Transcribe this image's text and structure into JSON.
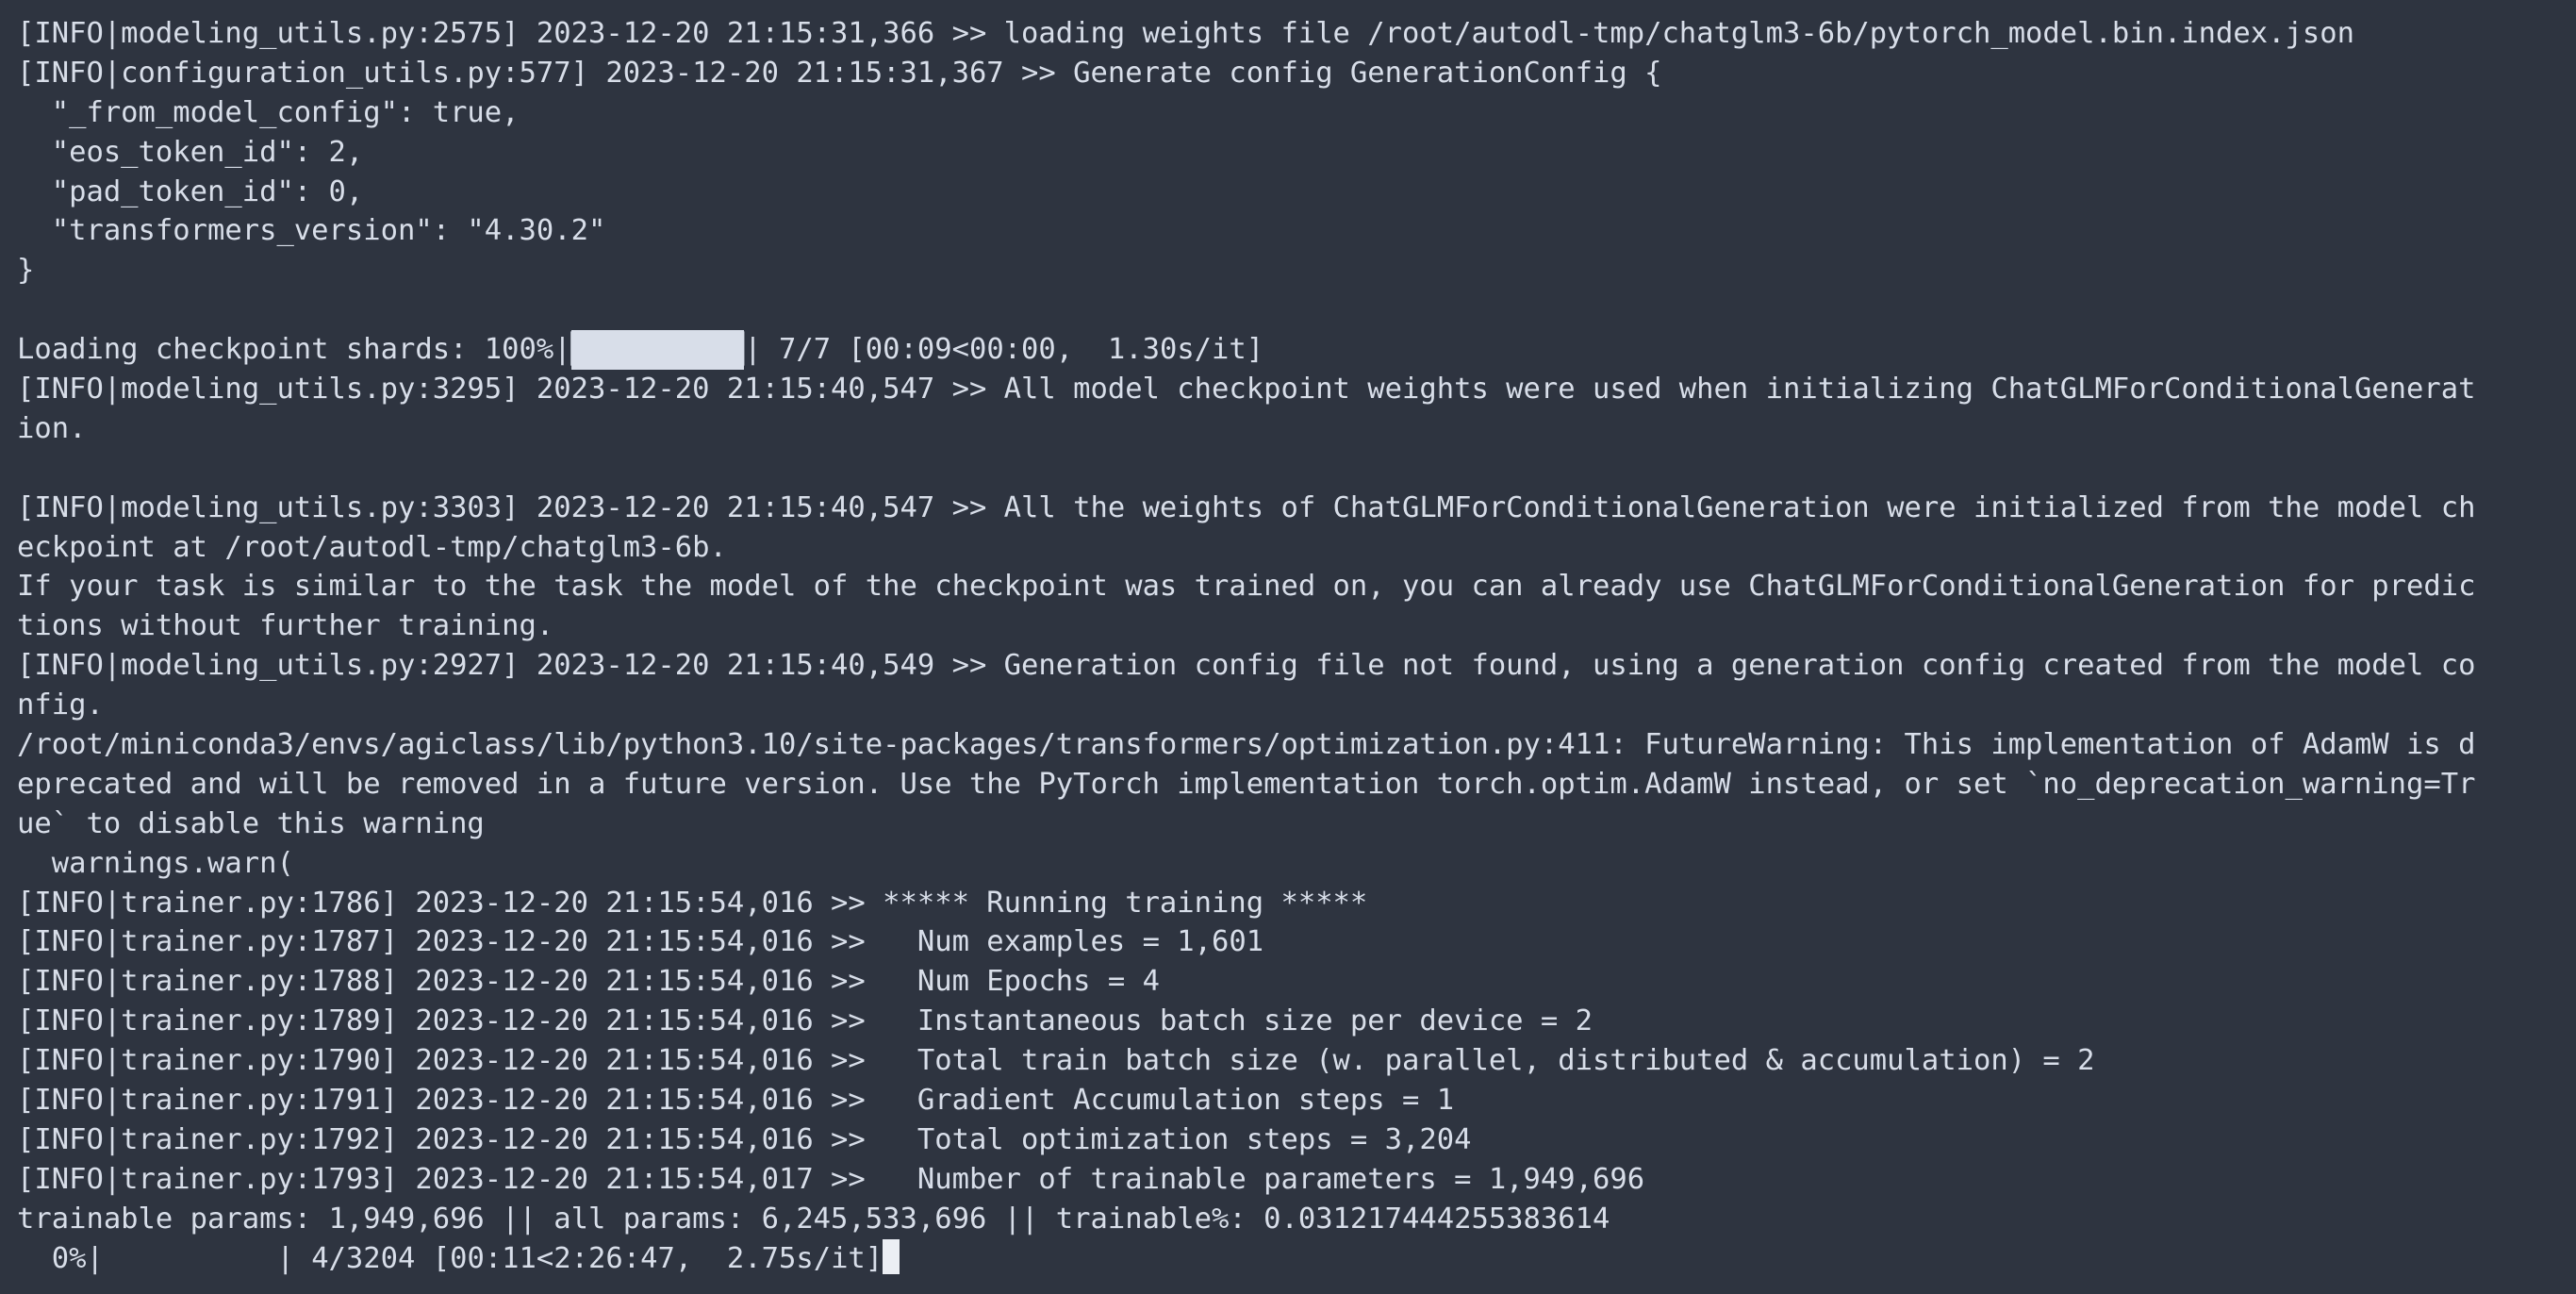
{
  "terminal": {
    "lines": [
      {
        "text": "[INFO|modeling_utils.py:2575] 2023-12-20 21:15:31,366 >> loading weights file /root/autodl-tmp/chatglm3-6b/pytorch_model.bin.index.json"
      },
      {
        "text": "[INFO|configuration_utils.py:577] 2023-12-20 21:15:31,367 >> Generate config GenerationConfig {"
      },
      {
        "text": "  \"_from_model_config\": true,"
      },
      {
        "text": "  \"eos_token_id\": 2,"
      },
      {
        "text": "  \"pad_token_id\": 0,"
      },
      {
        "text": "  \"transformers_version\": \"4.30.2\""
      },
      {
        "text": "}"
      },
      {
        "text": ""
      },
      {
        "progress": {
          "prefix": "Loading checkpoint shards: 100%|",
          "fill": "██████████",
          "empty": "",
          "suffix": "| 7/7 [00:09<00:00,  1.30s/it]",
          "percent": 100
        }
      },
      {
        "text": "[INFO|modeling_utils.py:3295] 2023-12-20 21:15:40,547 >> All model checkpoint weights were used when initializing ChatGLMForConditionalGenerat"
      },
      {
        "text": "ion."
      },
      {
        "text": ""
      },
      {
        "text": "[INFO|modeling_utils.py:3303] 2023-12-20 21:15:40,547 >> All the weights of ChatGLMForConditionalGeneration were initialized from the model ch"
      },
      {
        "text": "eckpoint at /root/autodl-tmp/chatglm3-6b."
      },
      {
        "text": "If your task is similar to the task the model of the checkpoint was trained on, you can already use ChatGLMForConditionalGeneration for predic"
      },
      {
        "text": "tions without further training."
      },
      {
        "text": "[INFO|modeling_utils.py:2927] 2023-12-20 21:15:40,549 >> Generation config file not found, using a generation config created from the model co"
      },
      {
        "text": "nfig."
      },
      {
        "text": "/root/miniconda3/envs/agiclass/lib/python3.10/site-packages/transformers/optimization.py:411: FutureWarning: This implementation of AdamW is d"
      },
      {
        "text": "eprecated and will be removed in a future version. Use the PyTorch implementation torch.optim.AdamW instead, or set `no_deprecation_warning=Tr"
      },
      {
        "text": "ue` to disable this warning"
      },
      {
        "text": "  warnings.warn("
      },
      {
        "text": "[INFO|trainer.py:1786] 2023-12-20 21:15:54,016 >> ***** Running training *****"
      },
      {
        "text": "[INFO|trainer.py:1787] 2023-12-20 21:15:54,016 >>   Num examples = 1,601"
      },
      {
        "text": "[INFO|trainer.py:1788] 2023-12-20 21:15:54,016 >>   Num Epochs = 4"
      },
      {
        "text": "[INFO|trainer.py:1789] 2023-12-20 21:15:54,016 >>   Instantaneous batch size per device = 2"
      },
      {
        "text": "[INFO|trainer.py:1790] 2023-12-20 21:15:54,016 >>   Total train batch size (w. parallel, distributed & accumulation) = 2"
      },
      {
        "text": "[INFO|trainer.py:1791] 2023-12-20 21:15:54,016 >>   Gradient Accumulation steps = 1"
      },
      {
        "text": "[INFO|trainer.py:1792] 2023-12-20 21:15:54,016 >>   Total optimization steps = 3,204"
      },
      {
        "text": "[INFO|trainer.py:1793] 2023-12-20 21:15:54,017 >>   Number of trainable parameters = 1,949,696"
      },
      {
        "text": "trainable params: 1,949,696 || all params: 6,245,533,696 || trainable%: 0.031217444255383614"
      },
      {
        "progress": {
          "prefix": "  0%|",
          "fill": "",
          "empty": "          ",
          "suffix": "| 4/3204 [00:11<2:26:47,  2.75s/it]",
          "percent": 0
        },
        "cursor": true
      }
    ]
  },
  "colors": {
    "background": "#2e3440",
    "foreground": "#d8dee9",
    "cursor": "#eceff4"
  }
}
